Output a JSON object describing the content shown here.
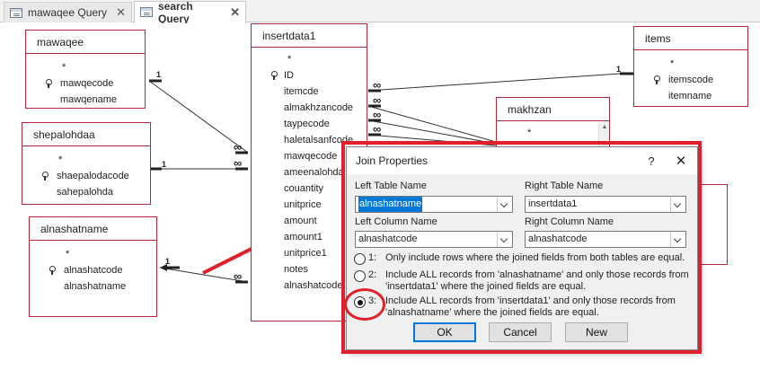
{
  "tabs": [
    {
      "label": "mawaqee Query",
      "active": false
    },
    {
      "label": "search Query",
      "active": true
    }
  ],
  "tables": {
    "mawaqee": {
      "title": "mawaqee",
      "fields": [
        "*",
        "mawqecode",
        "mawqename"
      ],
      "keys": [
        1
      ]
    },
    "shepalohdaa": {
      "title": "shepalohdaa",
      "fields": [
        "*",
        "shaepalodacode",
        "sahepalohda"
      ],
      "keys": [
        1
      ]
    },
    "alnashatname": {
      "title": "alnashatname",
      "fields": [
        "*",
        "alnashatcode",
        "alnashatname"
      ],
      "keys": [
        1
      ]
    },
    "insertdata1": {
      "title": "insertdata1",
      "fields": [
        "*",
        "ID",
        "itemcde",
        "almakhzancode",
        "taypecode",
        "haletalsanfcode",
        "mawqecode",
        "ameenalohda",
        "couantity",
        "unitprice",
        "amount",
        "amount1",
        "unitprice1",
        "notes",
        "alnashatcode"
      ],
      "keys": [
        1
      ]
    },
    "items": {
      "title": "items",
      "fields": [
        "*",
        "itemscode",
        "itemname"
      ],
      "keys": [
        1
      ]
    },
    "makhzan": {
      "title": "makhzan",
      "fields": [
        "*"
      ],
      "keys": []
    }
  },
  "relationships": {
    "one": "1",
    "many": "∞"
  },
  "dialog": {
    "title": "Join Properties",
    "help": "?",
    "close": "✕",
    "left_table_label": "Left Table Name",
    "left_table_value": "alnashatname",
    "right_table_label": "Right Table Name",
    "right_table_value": "insertdata1",
    "left_column_label": "Left Column Name",
    "left_column_value": "alnashatcode",
    "right_column_label": "Right Column Name",
    "right_column_value": "alnashatcode",
    "options": [
      {
        "num": "1:",
        "text": "Only include rows where the joined fields from both tables are equal.",
        "selected": false
      },
      {
        "num": "2:",
        "text": "Include ALL records from 'alnashatname' and only those records from 'insertdata1' where the joined fields are equal.",
        "selected": false
      },
      {
        "num": "3:",
        "text": "Include ALL records from 'insertdata1' and only those records from 'alnashatname' where the joined fields are equal.",
        "selected": true
      }
    ],
    "ok_label": "OK",
    "cancel_label": "Cancel",
    "new_label": "New"
  },
  "colors": {
    "table_border": "#b5283a",
    "annotation_red": "#e0202a",
    "accent": "#0078d7"
  }
}
